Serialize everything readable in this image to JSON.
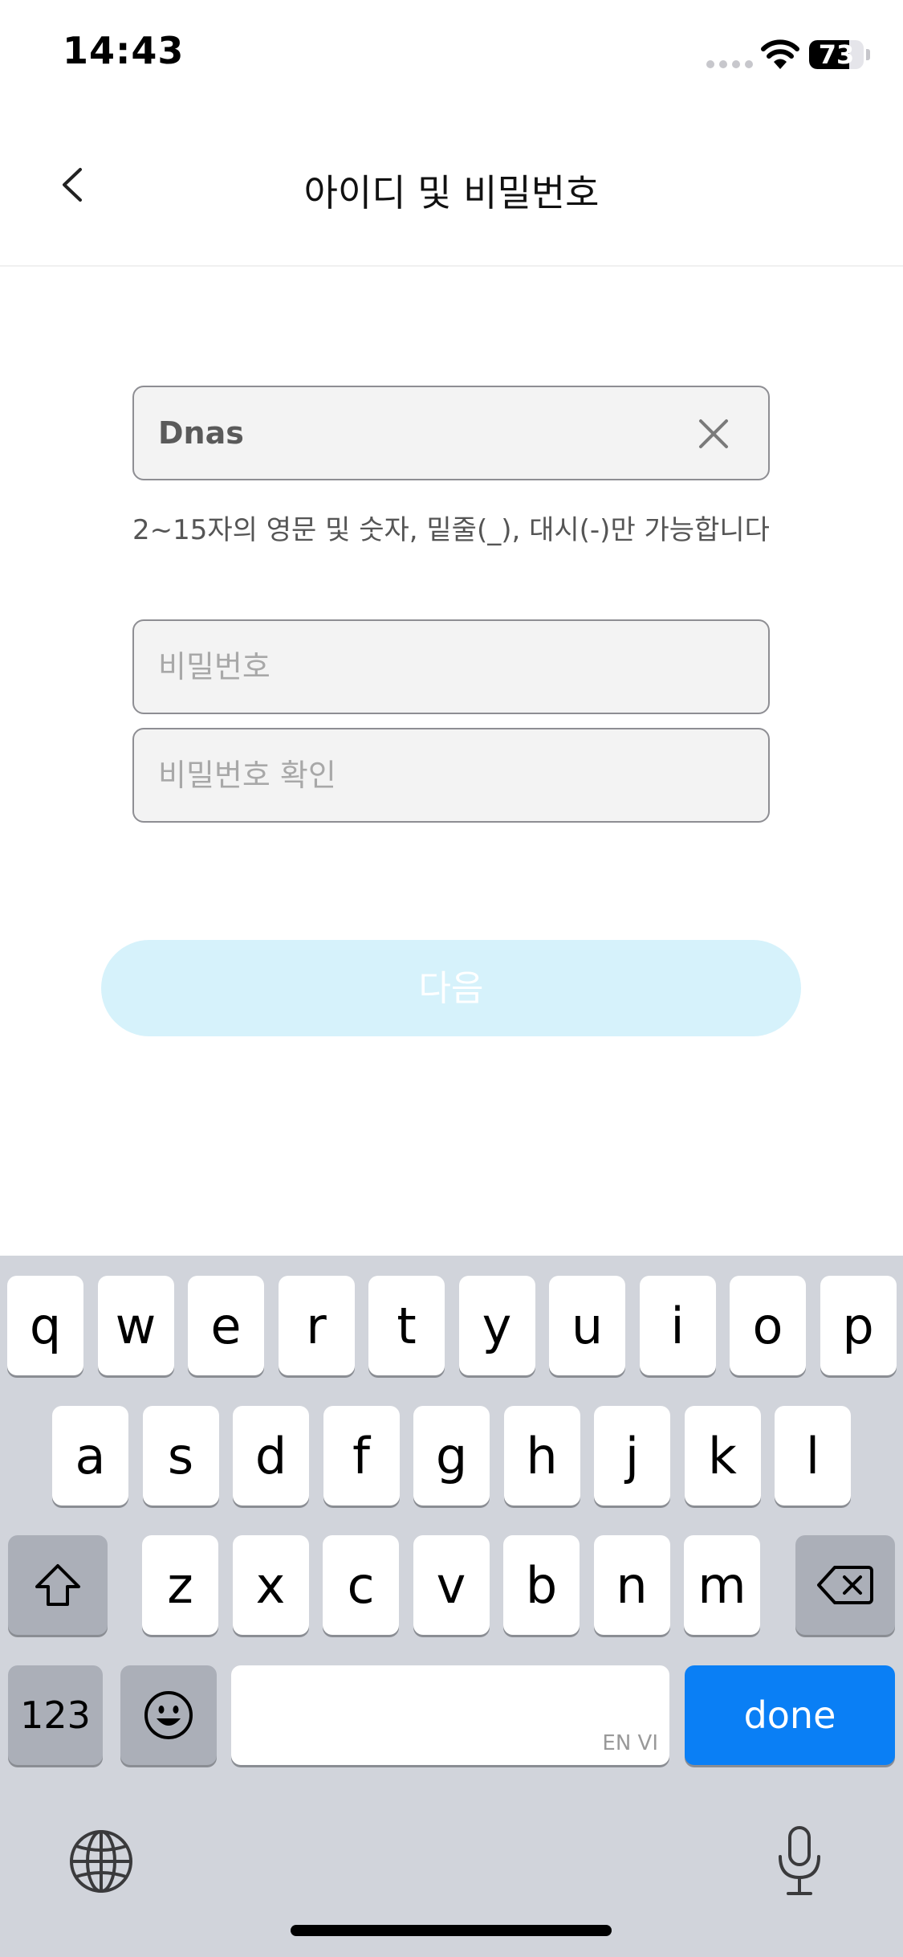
{
  "status_bar": {
    "time": "14:43",
    "battery": "73",
    "battery_level": 0.73
  },
  "nav": {
    "title": "아이디 및 비밀번호",
    "back_icon": "chevron-left-icon"
  },
  "form": {
    "id_value": "Dnas",
    "id_hint": "2~15자의 영문 및 숫자, 밑줄(_), 대시(-)만 가능합니다",
    "password_placeholder": "비밀번호",
    "password_confirm_placeholder": "비밀번호 확인",
    "next_label": "다음"
  },
  "colors": {
    "next_button_bg": "#d6f2fb",
    "done_key": "#0a7ff5",
    "keyboard_bg": "#d1d4db"
  },
  "keyboard": {
    "row1": [
      "q",
      "w",
      "e",
      "r",
      "t",
      "y",
      "u",
      "i",
      "o",
      "p"
    ],
    "row2": [
      "a",
      "s",
      "d",
      "f",
      "g",
      "h",
      "j",
      "k",
      "l"
    ],
    "row3": [
      "z",
      "x",
      "c",
      "v",
      "b",
      "n",
      "m"
    ],
    "numbers_label": "123",
    "space_sublabel": "EN VI",
    "done_label": "done",
    "icons": [
      "shift-icon",
      "delete-icon",
      "emoji-icon",
      "globe-icon",
      "microphone-icon"
    ]
  }
}
